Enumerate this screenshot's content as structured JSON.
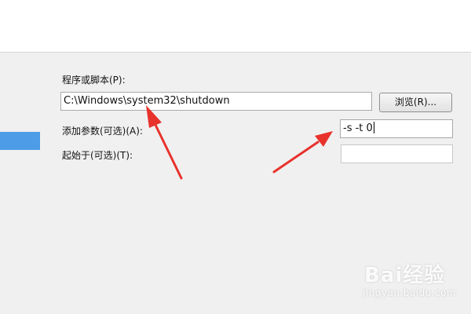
{
  "dialog": {
    "program_label": "程序或脚本(P):",
    "program_value": "C:\\Windows\\system32\\shutdown",
    "browse_label": "浏览(R)...",
    "arguments_label": "添加参数(可选)(A):",
    "arguments_value": "-s -t 0",
    "start_in_label": "起始于(可选)(T):",
    "start_in_value": ""
  },
  "annotations": {
    "arrow_color": "#e8322c"
  },
  "watermark": {
    "brand": "Bai经验",
    "url": "jingyan.baidu.com"
  }
}
